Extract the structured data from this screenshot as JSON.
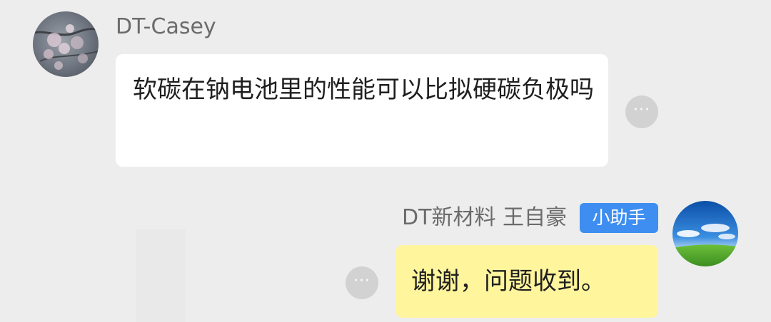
{
  "chat": {
    "messages": [
      {
        "sender": "DT-Casey",
        "text": "软碳在钠电池里的性能可以比拟硬碳负极吗",
        "side": "left",
        "bubble_color": "#ffffff",
        "avatar_icon": "blossom-photo-avatar",
        "more_icon": "more-options-icon"
      },
      {
        "sender": "DT新材料 王自豪",
        "badge": "小助手",
        "text": "谢谢，问题收到。",
        "side": "right",
        "bubble_color": "#fff59d",
        "badge_color": "#3d8ef0",
        "avatar_icon": "sky-meadow-photo-avatar",
        "more_icon": "more-options-icon"
      }
    ]
  },
  "icons": {
    "more": "···"
  },
  "colors": {
    "background": "#ededed",
    "name_text": "#6b6b6b",
    "message_text": "#1f1f1f",
    "more_button": "#d2d2d2"
  }
}
